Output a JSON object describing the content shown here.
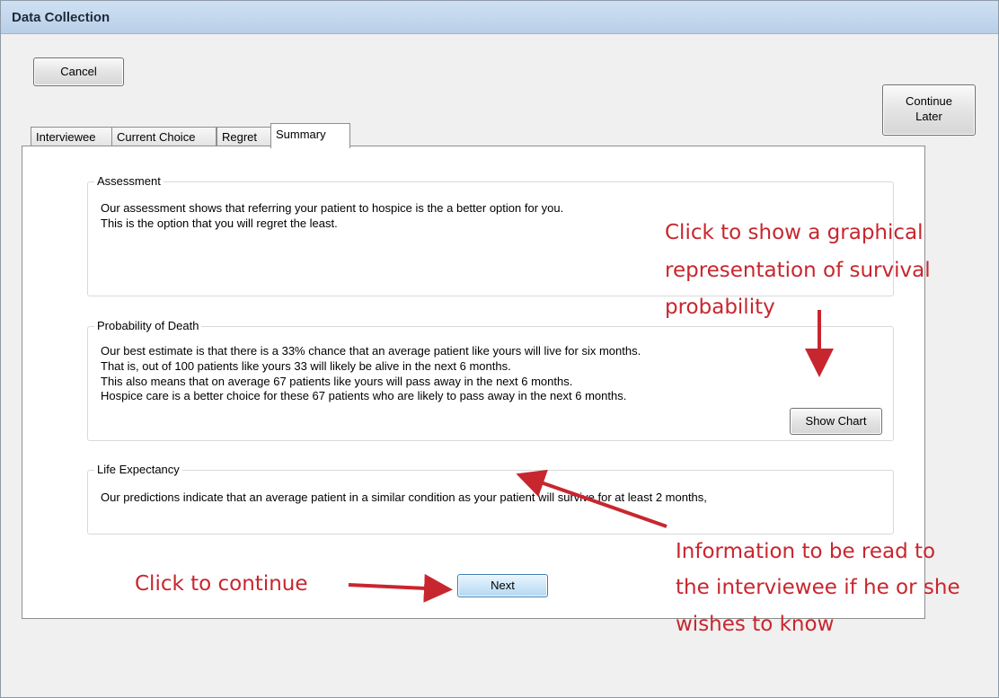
{
  "window": {
    "title": "Data Collection"
  },
  "toolbar": {
    "cancel_label": "Cancel",
    "continue_label_1": "Continue",
    "continue_label_2": "Later"
  },
  "tabs": [
    {
      "label": "Interviewee"
    },
    {
      "label": "Current Choice"
    },
    {
      "label": "Regret"
    },
    {
      "label": "Summary"
    }
  ],
  "assessment": {
    "title": "Assessment",
    "lines": [
      "Our assessment shows that referring your patient to hospice is the a better option for you.",
      "This is the option that you will regret the least."
    ]
  },
  "probability": {
    "title": "Probability of Death",
    "lines": [
      "Our best estimate is that there is a 33% chance that an average patient like yours will live for six months.",
      "That is, out of 100 patients like yours 33 will likely be alive in the next 6 months.",
      "This also means that on average 67 patients like yours will pass away in the next 6 months.",
      "Hospice care is a better choice for these 67 patients who are likely to pass away in the next 6 months."
    ],
    "show_chart_label": "Show Chart"
  },
  "life_expectancy": {
    "title": "Life Expectancy",
    "line": "Our predictions indicate that an average patient in a similar condition as your patient will survive for at least 2 months,"
  },
  "next_label": "Next",
  "annotations": {
    "chart_1": "Click to show a graphical",
    "chart_2": "representation of survival",
    "chart_3": "probability",
    "continue": "Click to continue",
    "info_1": "Information to be read to",
    "info_2": "the interviewee if he or she",
    "info_3": "wishes to know"
  },
  "colors": {
    "annotation": "#c8262e",
    "title_bar": "#b9cfe8"
  }
}
